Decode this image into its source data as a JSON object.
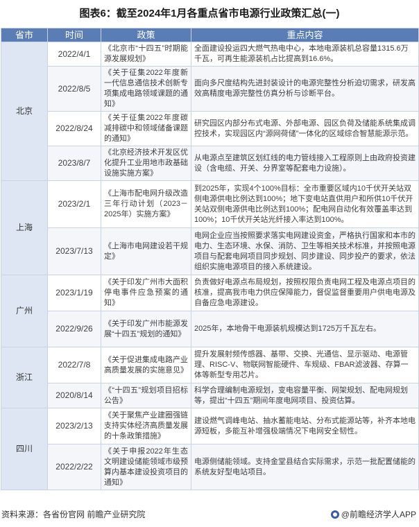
{
  "title": "图表6：截至2024年1月各重点省市电源行业政策汇总(一)",
  "headers": [
    "省市",
    "时间",
    "政策",
    "重点内容"
  ],
  "watermark": "前瞻产业研究院",
  "rows": [
    {
      "province": "北京",
      "date": "2022/4/1",
      "policy": "《北京市“十四五”时期能源发展规划》",
      "content": "全面建设投运四大燃气热电中心，本地电源装机总容量1315.6万千瓦，可再生能源装机占比提高到16.6%。"
    },
    {
      "province": "",
      "date": "2022/8/5",
      "policy": "《关于征集2022年度新一代信息通信技术创新专项集成电路领域课题的通知》",
      "content": "面向多尺度结构先进封装设计的电源完整性分析迫切需求，研发高效高精度电源完整性仿真分析与诊断平台。"
    },
    {
      "province": "",
      "date": "2022/8/24",
      "policy": "《关于征集2022年度碳减排碳中和领域储备课题的通知》",
      "content": "研究园区内部分布式电源、外部电源、园区负荷及储能系统集成调控技术，实现园区内“源网荷储”一体化的区域综合智慧能源示范。"
    },
    {
      "province": "",
      "date": "2023/8/7",
      "policy": "《北京经济技术开发区优化提升工业用地市政基础设施实施方案》",
      "content": "从电源点至建筑区划红线的电力管线接入工程原则上由政府投资建设（含电缆、开关、分界室等配套电力设施）。"
    },
    {
      "province": "上海",
      "date": "2023/2/1",
      "policy": "《上海市配电网升级改造三年行动计划（2023－2025年）实施方案》",
      "content": "到2025年，实现4个100%目标：全市重要区域内10千伏开关站双侧电源供电比例达到100%；地下变电站直供用户和所供10千伏开关站双侧电源供电比例达到100%；配电网自动化有效覆盖率达到100%；10千伏开关站光纤接入率达到100%。"
    },
    {
      "province": "",
      "date": "2023/7/13",
      "policy": "《上海市电网建设若干规定》",
      "content": "电网企业应当按照要求落实电网建设资金，严格执行国家和本市的电力、生态环境、水保、消防、卫生等相关技术标准，并按照电源项目与配套电网项目同步规划、同步建设、同步投产的要求，依法组织实施电源项目的接入系统建设。"
    },
    {
      "province": "广州",
      "date": "2023/1/19",
      "policy": "《关于印发广州市大面积停电事件应急预案的通知》",
      "content": "负责做好电源点布局规划，按照权限负责电网工程及电源点项目的核准，提高我市电力供应保障能力，督促监督重要用户供电电源及自备应急电源建设。"
    },
    {
      "province": "",
      "date": "2022/9/26",
      "policy": "《关于印发广州市能源发展“十四五”规划的通知》",
      "content": "2025年，本地骨干电源装机规模达到1725万千瓦左右。"
    },
    {
      "province": "浙江",
      "date": "2022/7/8",
      "policy": "《关于促进集成电路产业高质量发展的实施意见》",
      "content": "提升发展射频传感器、基带、交换、光通信、显示驱动、电源管理、RISC-V、物联网智能硬件、车规级、FBAR滤波器、存算一体等新型专用芯片。"
    },
    {
      "province": "",
      "date": "2020/8/14",
      "policy": "《“十四五”规划项目招标公告》",
      "content": "科学合理编制电源规划，变电容量平衡、网架规划、配电网规划等，提出“十四五”期间年度电网项目、投资估算。"
    },
    {
      "province": "四川",
      "date": "2023/2/13",
      "policy": "《关于聚焦产业建圈强链支持实体经济高质量发展的十条政策措施》",
      "content": "建设燃气调峰电站、抽水蓄能电站、分布式能源站等，补齐本地电源短板，多能互补增强极端情况下电网安全韧性。"
    },
    {
      "province": "",
      "date": "2022/2/22",
      "policy": "《关于申报2022年生态文明建设储能领域市级预算内基本建设投资项目的通知》",
      "content": "电源侧储能领域。支持金堂县结合实际需求，示范一批配置储能的系统友好型电站项目。"
    }
  ],
  "footer": {
    "source": "资料来源：各省份官网 前瞻产业研究院",
    "brand": "@前瞻经济学人APP"
  }
}
